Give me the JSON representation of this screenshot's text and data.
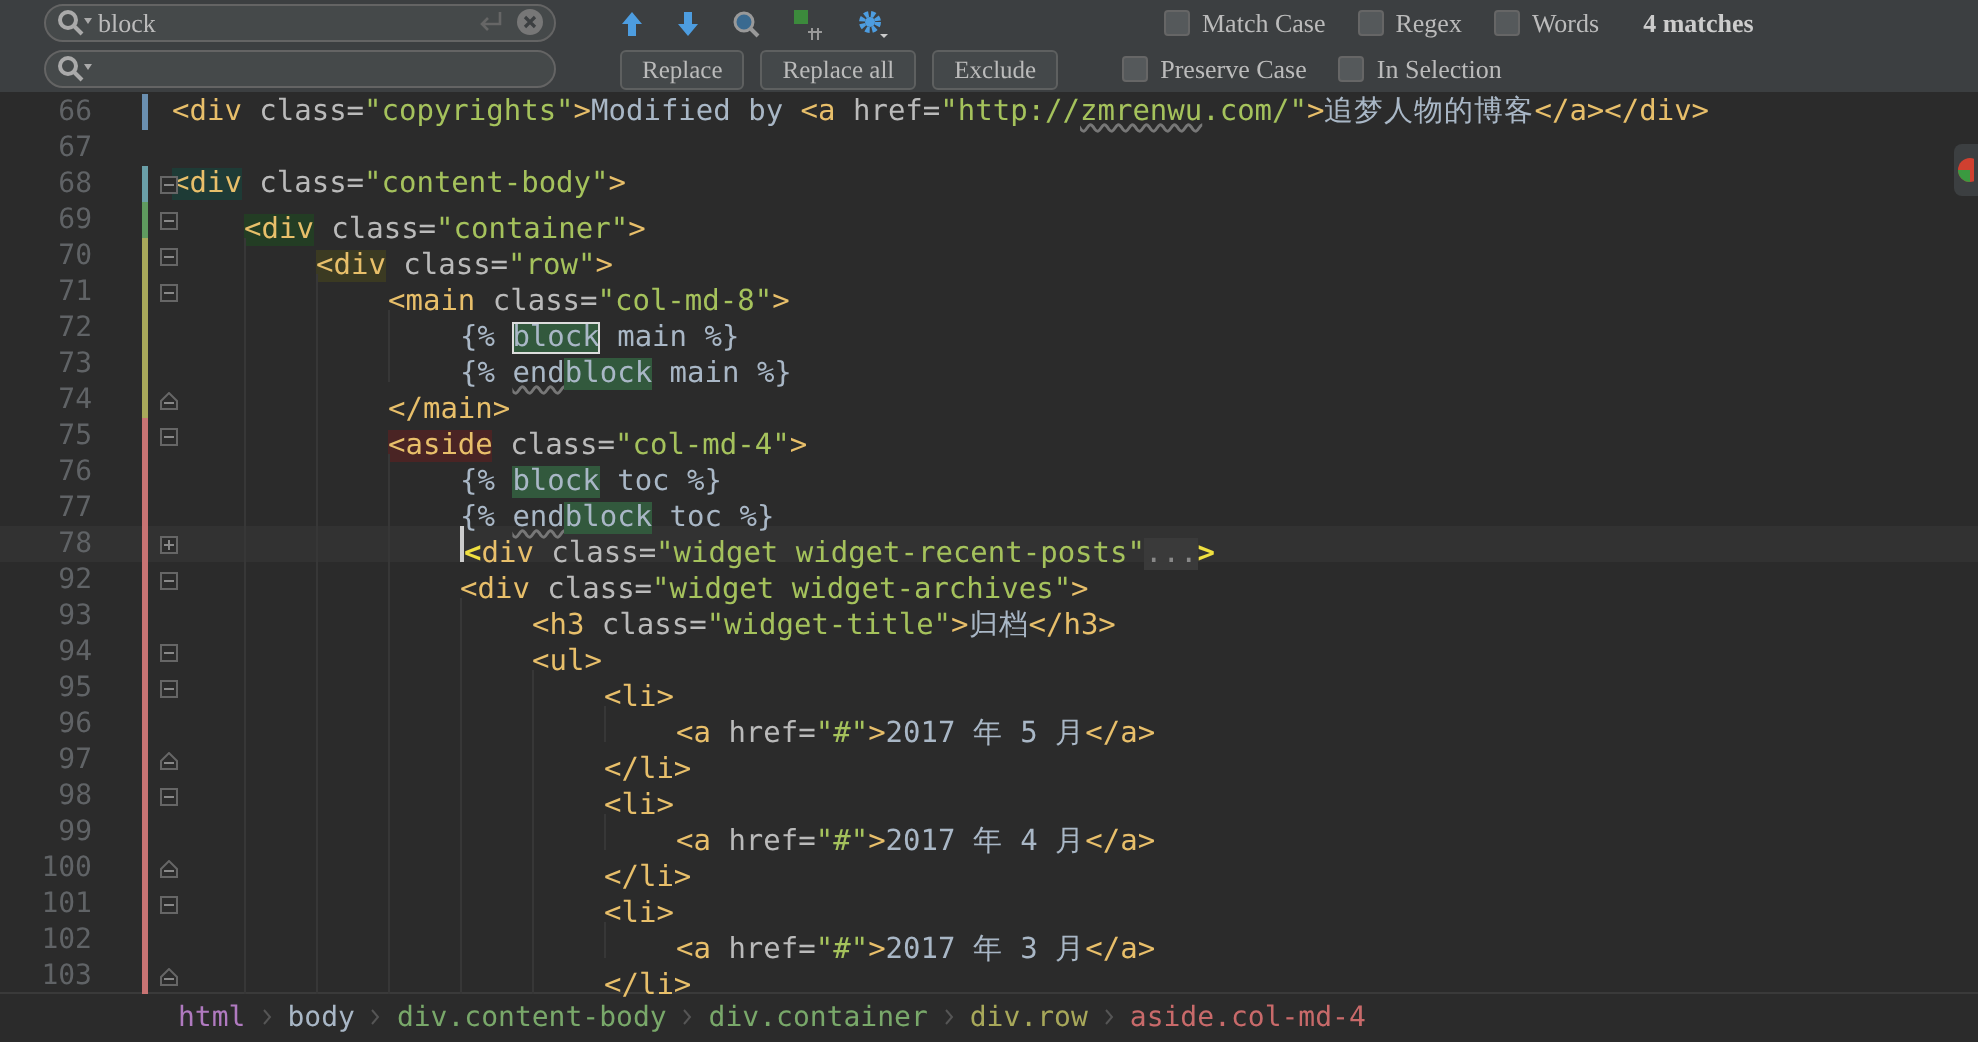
{
  "find_bar": {
    "search_value": "block",
    "buttons": [
      "Replace",
      "Replace all",
      "Exclude"
    ],
    "options_row1": [
      {
        "label": "Match Case",
        "checked": false
      },
      {
        "label": "Regex",
        "checked": false
      },
      {
        "label": "Words",
        "checked": false
      }
    ],
    "match_count": "4 matches",
    "options_row2": [
      {
        "label": "Preserve Case",
        "checked": false
      },
      {
        "label": "In Selection",
        "checked": false
      }
    ]
  },
  "lines": [
    {
      "number": "66",
      "kind": "plain",
      "current": false,
      "color": "#6a8fb0",
      "tokens": [
        {
          "kind": "tag",
          "text": "<div"
        },
        {
          "kind": "attr",
          "text": " class="
        },
        {
          "kind": "str",
          "text": "\"copyrights\""
        },
        {
          "kind": "tag",
          "text": ">"
        },
        {
          "kind": "text",
          "text": "Modified by "
        },
        {
          "kind": "tag",
          "text": "<a"
        },
        {
          "kind": "attr",
          "text": " href="
        },
        {
          "kind": "str",
          "text": "\"http://"
        },
        {
          "kind": "str_typo",
          "text": "zmrenwu"
        },
        {
          "kind": "str",
          "text": ".com/\""
        },
        {
          "kind": "tag",
          "text": ">"
        },
        {
          "kind": "text",
          "text": "追梦人物的博客"
        },
        {
          "kind": "tag",
          "text": "</a></div>"
        }
      ]
    },
    {
      "number": "67",
      "kind": "plain",
      "current": false
    },
    {
      "number": "68",
      "kind": "fold_start",
      "current": false,
      "color": "#6a9fa8",
      "tokens": [
        {
          "kind": "tag",
          "text": "<div",
          "color": "#1e3b36"
        },
        {
          "kind": "attr",
          "text": " class="
        },
        {
          "kind": "str",
          "text": "\"content-body\""
        },
        {
          "kind": "tag",
          "text": ">"
        }
      ],
      "children": [
        {
          "number": "69",
          "kind": "fold_start",
          "current": false,
          "color": "#5f9a5f",
          "tokens": [
            {
              "kind": "tag",
              "text": "<div",
              "color": "#233d24"
            },
            {
              "kind": "attr",
              "text": " class="
            },
            {
              "kind": "str",
              "text": "\"container\""
            },
            {
              "kind": "tag",
              "text": ">"
            }
          ],
          "children": [
            {
              "number": "70",
              "kind": "fold_start",
              "current": false,
              "color": "#a8a85a",
              "tokens": [
                {
                  "kind": "tag",
                  "text": "<div",
                  "color": "#3b3a22"
                },
                {
                  "kind": "attr",
                  "text": " class="
                },
                {
                  "kind": "str",
                  "text": "\"row\""
                },
                {
                  "kind": "tag",
                  "text": ">"
                }
              ],
              "children": [
                {
                  "number": "71",
                  "kind": "fold_start",
                  "current": false,
                  "color": "#a8a85a",
                  "tokens": [
                    {
                      "kind": "tag",
                      "text": "<main"
                    },
                    {
                      "kind": "attr",
                      "text": " class="
                    },
                    {
                      "kind": "str",
                      "text": "\"col-md-8\""
                    },
                    {
                      "kind": "tag",
                      "text": ">"
                    }
                  ],
                  "children": [
                    {
                      "number": "72",
                      "kind": "plain",
                      "current": false,
                      "color": "#a8a85a",
                      "tokens": [
                        {
                          "kind": "text",
                          "text": "{% "
                        },
                        {
                          "kind": "match_current",
                          "text": "block"
                        },
                        {
                          "kind": "text",
                          "text": " main %}"
                        }
                      ]
                    },
                    {
                      "number": "73",
                      "kind": "plain",
                      "current": false,
                      "color": "#a8a85a",
                      "tokens": [
                        {
                          "kind": "text",
                          "text": "{% "
                        },
                        {
                          "kind": "typo",
                          "text": "end"
                        },
                        {
                          "kind": "match",
                          "text": "block"
                        },
                        {
                          "kind": "text",
                          "text": " main %}"
                        }
                      ]
                    }
                  ]
                },
                {
                  "number": "74",
                  "kind": "fold_end",
                  "current": false,
                  "color": "#a8a85a",
                  "tokens": [
                    {
                      "kind": "tag",
                      "text": "</main>"
                    }
                  ]
                },
                {
                  "number": "75",
                  "kind": "fold_start",
                  "current": false,
                  "color": "#c87373",
                  "tokens": [
                    {
                      "kind": "tag",
                      "text": "<aside",
                      "color": "#4a2424"
                    },
                    {
                      "kind": "attr",
                      "text": " class="
                    },
                    {
                      "kind": "str",
                      "text": "\"col-md-4\""
                    },
                    {
                      "kind": "tag",
                      "text": ">"
                    }
                  ],
                  "children": [
                    {
                      "number": "76",
                      "kind": "plain",
                      "current": false,
                      "color": "#c87373",
                      "tokens": [
                        {
                          "kind": "text",
                          "text": "{% "
                        },
                        {
                          "kind": "match",
                          "text": "block"
                        },
                        {
                          "kind": "text",
                          "text": " toc %}"
                        }
                      ]
                    },
                    {
                      "number": "77",
                      "kind": "plain",
                      "current": false,
                      "color": "#c87373",
                      "tokens": [
                        {
                          "kind": "text",
                          "text": "{% "
                        },
                        {
                          "kind": "typo",
                          "text": "end"
                        },
                        {
                          "kind": "match",
                          "text": "block"
                        },
                        {
                          "kind": "text",
                          "text": " toc %}"
                        }
                      ]
                    },
                    {
                      "number": "78",
                      "kind": "folded",
                      "current": true,
                      "color": "#c87373",
                      "tokens": [
                        {
                          "kind": "tag_bright",
                          "text": "<"
                        },
                        {
                          "kind": "tag",
                          "text": "div"
                        },
                        {
                          "kind": "attr",
                          "text": " class="
                        },
                        {
                          "kind": "str",
                          "text": "\"widget widget-recent-posts\""
                        },
                        {
                          "kind": "folded",
                          "text": "..."
                        },
                        {
                          "kind": "tag_bright",
                          "text": ">"
                        }
                      ]
                    },
                    {
                      "number": "92",
                      "kind": "fold_start",
                      "current": false,
                      "color": "#c87373",
                      "tokens": [
                        {
                          "kind": "tag",
                          "text": "<div"
                        },
                        {
                          "kind": "attr",
                          "text": " class="
                        },
                        {
                          "kind": "str",
                          "text": "\"widget widget-archives\""
                        },
                        {
                          "kind": "tag",
                          "text": ">"
                        }
                      ],
                      "children": [
                        {
                          "number": "93",
                          "kind": "plain",
                          "current": false,
                          "color": "#c87373",
                          "tokens": [
                            {
                              "kind": "tag",
                              "text": "<h3"
                            },
                            {
                              "kind": "attr",
                              "text": " class="
                            },
                            {
                              "kind": "str",
                              "text": "\"widget-title\""
                            },
                            {
                              "kind": "tag",
                              "text": ">"
                            },
                            {
                              "kind": "text",
                              "text": "归档"
                            },
                            {
                              "kind": "tag",
                              "text": "</h3>"
                            }
                          ]
                        },
                        {
                          "number": "94",
                          "kind": "fold_start",
                          "current": false,
                          "color": "#c87373",
                          "tokens": [
                            {
                              "kind": "tag",
                              "text": "<ul>"
                            }
                          ],
                          "children": [
                            {
                              "number": "95",
                              "kind": "fold_start",
                              "current": false,
                              "color": "#c87373",
                              "tokens": [
                                {
                                  "kind": "tag",
                                  "text": "<li>"
                                }
                              ],
                              "children": [
                                {
                                  "number": "96",
                                  "kind": "plain",
                                  "current": false,
                                  "color": "#c87373",
                                  "tokens": [
                                    {
                                      "kind": "tag",
                                      "text": "<a"
                                    },
                                    {
                                      "kind": "attr",
                                      "text": " href="
                                    },
                                    {
                                      "kind": "str",
                                      "text": "\"#\""
                                    },
                                    {
                                      "kind": "tag",
                                      "text": ">"
                                    },
                                    {
                                      "kind": "text",
                                      "text": "2017 年 5 月"
                                    },
                                    {
                                      "kind": "tag",
                                      "text": "</a>"
                                    }
                                  ]
                                }
                              ]
                            },
                            {
                              "number": "97",
                              "kind": "fold_end",
                              "current": false,
                              "color": "#c87373",
                              "tokens": [
                                {
                                  "kind": "tag",
                                  "text": "</li>"
                                }
                              ]
                            },
                            {
                              "number": "98",
                              "kind": "fold_start",
                              "current": false,
                              "color": "#c87373",
                              "tokens": [
                                {
                                  "kind": "tag",
                                  "text": "<li>"
                                }
                              ],
                              "children": [
                                {
                                  "number": "99",
                                  "kind": "plain",
                                  "current": false,
                                  "color": "#c87373",
                                  "tokens": [
                                    {
                                      "kind": "tag",
                                      "text": "<a"
                                    },
                                    {
                                      "kind": "attr",
                                      "text": " href="
                                    },
                                    {
                                      "kind": "str",
                                      "text": "\"#\""
                                    },
                                    {
                                      "kind": "tag",
                                      "text": ">"
                                    },
                                    {
                                      "kind": "text",
                                      "text": "2017 年 4 月"
                                    },
                                    {
                                      "kind": "tag",
                                      "text": "</a>"
                                    }
                                  ]
                                }
                              ]
                            },
                            {
                              "number": "100",
                              "kind": "fold_end",
                              "current": false,
                              "color": "#c87373",
                              "tokens": [
                                {
                                  "kind": "tag",
                                  "text": "</li>"
                                }
                              ]
                            },
                            {
                              "number": "101",
                              "kind": "fold_start",
                              "current": false,
                              "color": "#c87373",
                              "tokens": [
                                {
                                  "kind": "tag",
                                  "text": "<li>"
                                }
                              ],
                              "children": [
                                {
                                  "number": "102",
                                  "kind": "plain",
                                  "current": false,
                                  "color": "#c87373",
                                  "tokens": [
                                    {
                                      "kind": "tag",
                                      "text": "<a"
                                    },
                                    {
                                      "kind": "attr",
                                      "text": " href="
                                    },
                                    {
                                      "kind": "str",
                                      "text": "\"#\""
                                    },
                                    {
                                      "kind": "tag",
                                      "text": ">"
                                    },
                                    {
                                      "kind": "text",
                                      "text": "2017 年 3 月"
                                    },
                                    {
                                      "kind": "tag",
                                      "text": "</a>"
                                    }
                                  ]
                                }
                              ]
                            },
                            {
                              "number": "103",
                              "kind": "fold_end",
                              "current": false,
                              "color": "#c87373",
                              "tokens": [
                                {
                                  "kind": "tag",
                                  "text": "</li>"
                                }
                              ]
                            }
                          ]
                        }
                      ]
                    }
                  ]
                }
              ]
            }
          ]
        }
      ]
    }
  ],
  "breadcrumb": [
    {
      "label": "html",
      "color": "#b07ac0"
    },
    {
      "label": "body",
      "color": "#a9b7c6"
    },
    {
      "label": "div.content-body",
      "color": "#79a86a"
    },
    {
      "label": "div.container",
      "color": "#79a86a"
    },
    {
      "label": "div.row",
      "color": "#a8a85a"
    },
    {
      "label": "aside.col-md-4",
      "color": "#c86a6a"
    }
  ]
}
